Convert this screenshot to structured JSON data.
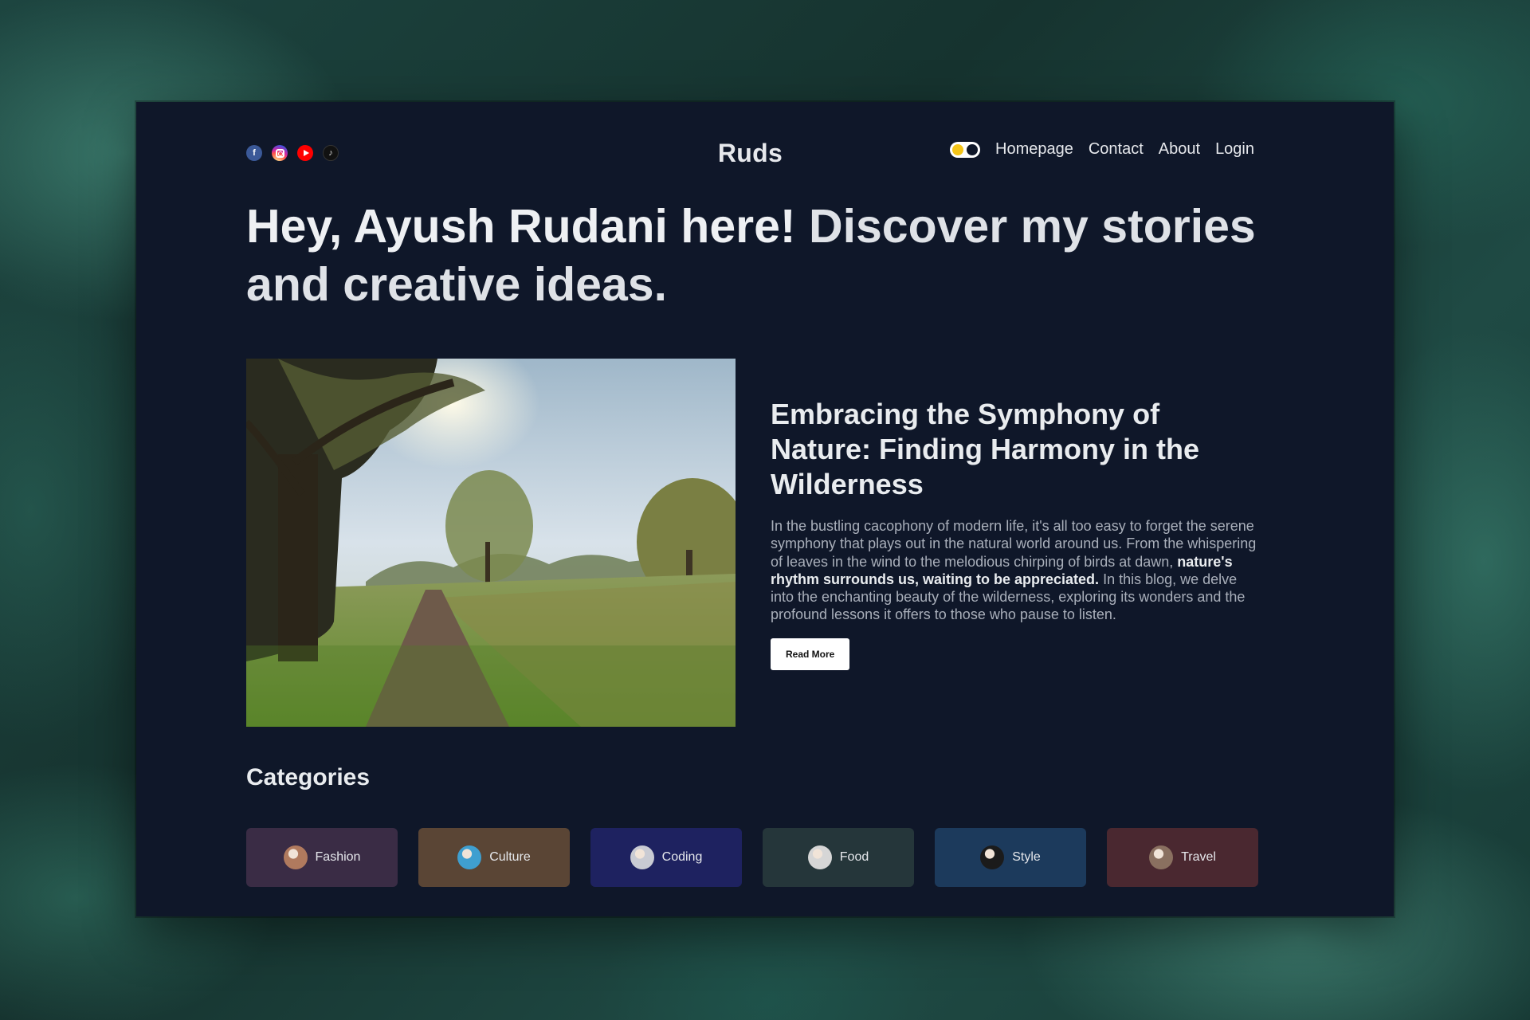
{
  "site": {
    "logo": "Ruds",
    "socials": [
      {
        "name": "facebook",
        "icon": "facebook-icon",
        "glyph": "f"
      },
      {
        "name": "instagram",
        "icon": "instagram-icon"
      },
      {
        "name": "youtube",
        "icon": "youtube-icon"
      },
      {
        "name": "tiktok",
        "icon": "tiktok-icon",
        "glyph": "♪"
      }
    ],
    "nav": {
      "theme_toggle": "on",
      "items": [
        "Homepage",
        "Contact",
        "About",
        "Login"
      ]
    }
  },
  "hero": {
    "bold": "Hey, Ayush Rudani here!",
    "rest": " Discover my stories and creative ideas."
  },
  "featured": {
    "title": "Embracing the Symphony of Nature: Finding Harmony in the Wilderness",
    "body_start": "In the bustling cacophony of modern life, it's all too easy to forget the serene symphony that plays out in the natural world around us. From the whispering of leaves in the wind to the melodious chirping of birds at dawn, ",
    "body_bold": "nature's rhythm surrounds us, waiting to be appreciated.",
    "body_end": " In this blog, we delve into the enchanting beauty of the wilderness, exploring its wonders and the profound lessons it offers to those who pause to listen.",
    "button": "Read More"
  },
  "categories": {
    "heading": "Categories",
    "items": [
      {
        "label": "Fashion",
        "bg": "#3a2c45",
        "avatar": "#b07a5e"
      },
      {
        "label": "Culture",
        "bg": "#5a4535",
        "avatar": "#3f9fd0"
      },
      {
        "label": "Coding",
        "bg": "#1e2260",
        "avatar": "#c9cbd3"
      },
      {
        "label": "Food",
        "bg": "#25363a",
        "avatar": "#d6d6d6"
      },
      {
        "label": "Style",
        "bg": "#1c3a5c",
        "avatar": "#1b1b1b"
      },
      {
        "label": "Travel",
        "bg": "#4a2830",
        "avatar": "#8a7060"
      }
    ]
  }
}
